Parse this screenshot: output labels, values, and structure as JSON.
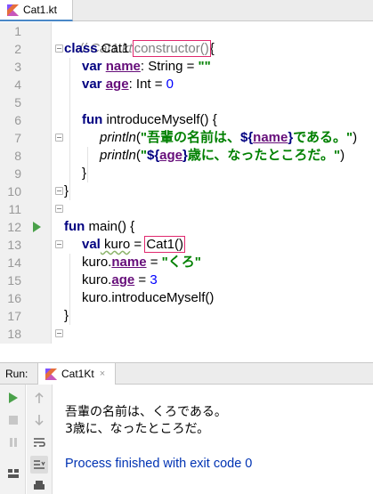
{
  "editor_tab": {
    "label": "Cat1.kt",
    "icon": "kotlin-file-icon"
  },
  "line_numbers": [
    "1",
    "2",
    "3",
    "4",
    "5",
    "6",
    "7",
    "8",
    "9",
    "10",
    "11",
    "12",
    "13",
    "14",
    "15",
    "16",
    "17",
    "18"
  ],
  "code": {
    "l1_comment": "// Cat1.kt",
    "l2_class": "class",
    "l2_name": " Cat1 ",
    "l2_ctor": "constructor()",
    "l2_brace": "{",
    "l3_var": "var",
    "l3_sp": " ",
    "l3_prop": "name",
    "l3_rest1": ": String = ",
    "l3_str": "\"\"",
    "l4_var": "var",
    "l4_sp": " ",
    "l4_prop": "age",
    "l4_rest1": ": Int = ",
    "l4_num": "0",
    "l6_fun": "fun",
    "l6_rest": " introduceMyself() {",
    "l7_fn": "println",
    "l7_paren": "(",
    "l7_str1": "\"吾輩の名前は、",
    "l7_tmpl_open": "${",
    "l7_prop": "name",
    "l7_tmpl_close": "}",
    "l7_str2": "である。\"",
    "l7_end": ")",
    "l8_fn": "println",
    "l8_paren": "(",
    "l8_str1": "\"",
    "l8_tmpl_open": "${",
    "l8_prop": "age",
    "l8_tmpl_close": "}",
    "l8_str2": "歳に、なったところだ。\"",
    "l8_end": ")",
    "l9_brace": "}",
    "l10_brace": "}",
    "l12_fun": "fun",
    "l12_rest": " main() {",
    "l13_val": "val",
    "l13_var": " kuro",
    "l13_eq": " = ",
    "l13_call": "Cat1()",
    "l14_obj": "kuro.",
    "l14_prop": "name",
    "l14_eq": " = ",
    "l14_str": "\"くろ\"",
    "l15_obj": "kuro.",
    "l15_prop": "age",
    "l15_eq": " = ",
    "l15_num": "3",
    "l16_call": "kuro.introduceMyself()",
    "l17_brace": "}"
  },
  "run_panel": {
    "label": "Run:",
    "tab_label": "Cat1Kt",
    "tab_close": "×",
    "output": [
      "吾輩の名前は、くろである。",
      "3歳に、なったところだ。"
    ],
    "exit_message": "Process finished with exit code 0"
  },
  "colors": {
    "keyword": "#000080",
    "string": "#008000",
    "number": "#0000ff",
    "property": "#660e7a",
    "comment": "#808080",
    "highlight_box": "#e0286e",
    "run_green": "#4aa14a",
    "exit_blue": "#0033b3"
  }
}
